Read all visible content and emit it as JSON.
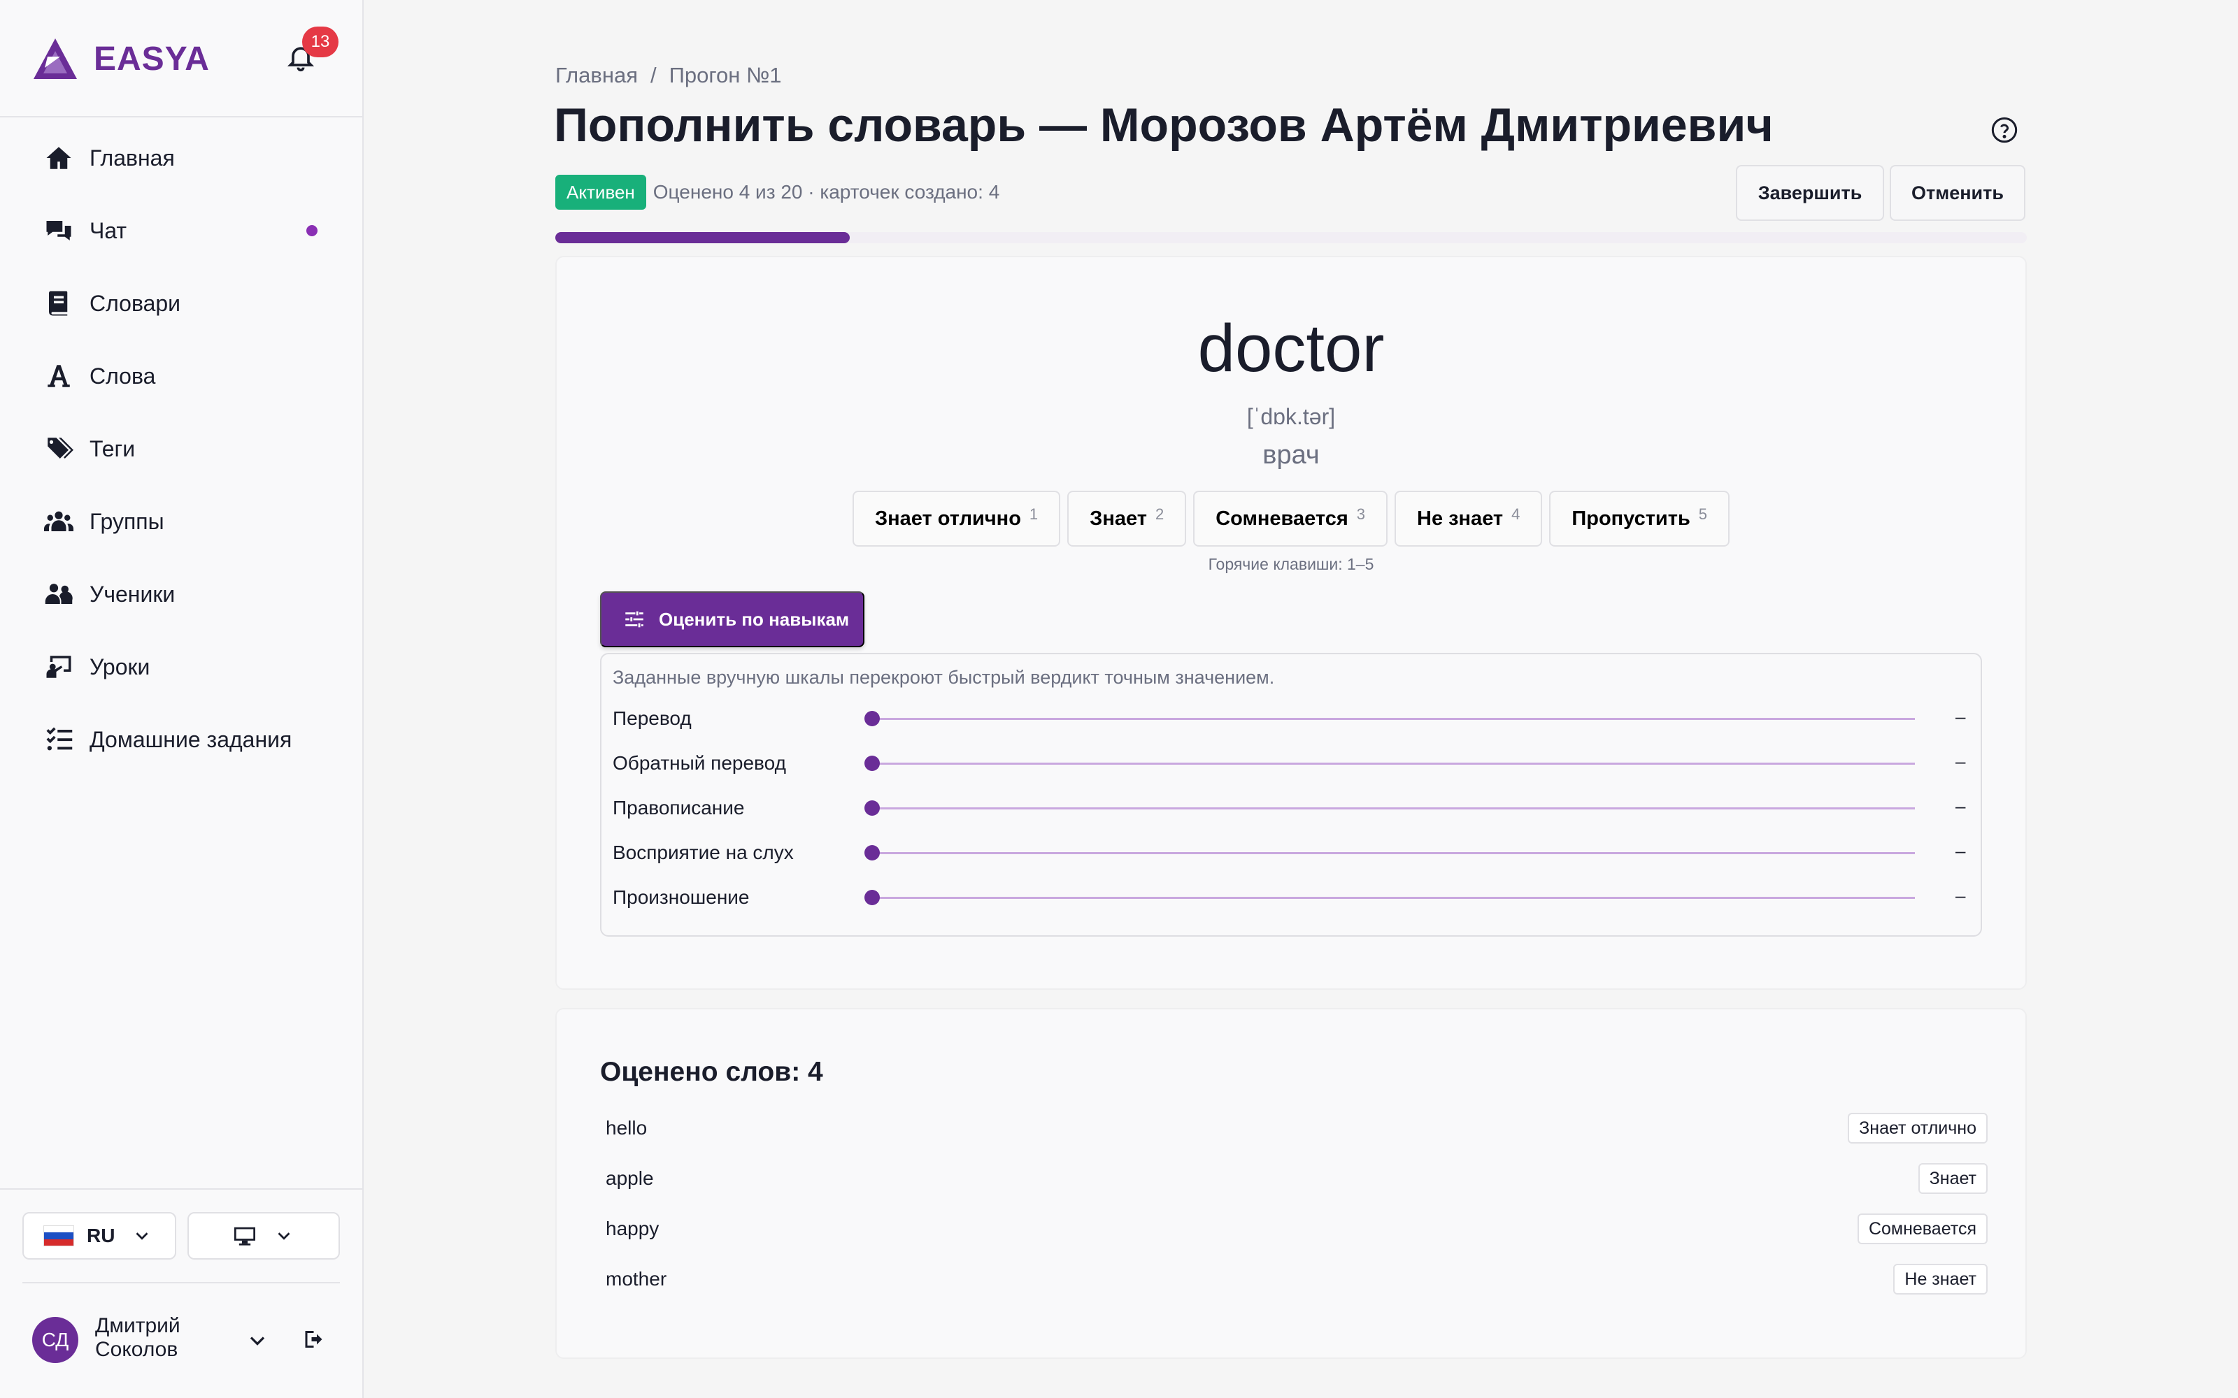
{
  "app": {
    "brand": "EASYA",
    "notifications_count": "13"
  },
  "sidebar": {
    "items": [
      {
        "label": "Главная",
        "icon": "home-icon"
      },
      {
        "label": "Чат",
        "icon": "chat-icon",
        "unread_dot": true
      },
      {
        "label": "Словари",
        "icon": "book-icon"
      },
      {
        "label": "Слова",
        "icon": "letter-a-icon"
      },
      {
        "label": "Теги",
        "icon": "tags-icon"
      },
      {
        "label": "Группы",
        "icon": "users-group-icon"
      },
      {
        "label": "Ученики",
        "icon": "students-icon"
      },
      {
        "label": "Уроки",
        "icon": "lesson-icon"
      },
      {
        "label": "Домашние задания",
        "icon": "homework-list-icon"
      }
    ],
    "language": "RU",
    "theme_icon": "monitor-icon",
    "user": {
      "initials": "СД",
      "name": "Дмитрий Соколов"
    }
  },
  "breadcrumb": {
    "home": "Главная",
    "separator": "/",
    "current": "Прогон №1"
  },
  "page": {
    "title": "Пополнить словарь — Морозов Артём Дмитриевич",
    "status": "Активен",
    "meta": "Оценено 4 из 20 · карточек создано: 4",
    "finish_label": "Завершить",
    "cancel_label": "Отменить",
    "progress": {
      "done": 4,
      "total": 20
    }
  },
  "card": {
    "word": "doctor",
    "ipa": "[ˈdɒk.tər]",
    "translation": "врач",
    "verdicts": [
      {
        "label": "Знает отлично",
        "key": "1"
      },
      {
        "label": "Знает",
        "key": "2"
      },
      {
        "label": "Сомневается",
        "key": "3"
      },
      {
        "label": "Не знает",
        "key": "4"
      },
      {
        "label": "Пропустить",
        "key": "5"
      }
    ],
    "hotkeys": "Горячие клавиши: 1–5",
    "skill_button": "Оценить по навыкам",
    "skills_note": "Заданные вручную шкалы перекроют быстрый вердикт точным значением.",
    "skills": [
      {
        "label": "Перевод",
        "value": "–"
      },
      {
        "label": "Обратный перевод",
        "value": "–"
      },
      {
        "label": "Правописание",
        "value": "–"
      },
      {
        "label": "Восприятие на слух",
        "value": "–"
      },
      {
        "label": "Произношение",
        "value": "–"
      }
    ]
  },
  "rated": {
    "title": "Оценено слов: 4",
    "items": [
      {
        "word": "hello",
        "verdict": "Знает отлично"
      },
      {
        "word": "apple",
        "verdict": "Знает"
      },
      {
        "word": "happy",
        "verdict": "Сомневается"
      },
      {
        "word": "mother",
        "verdict": "Не знает"
      }
    ]
  },
  "colors": {
    "accent": "#6a2d97",
    "status_active": "#18b07a",
    "badge": "#e53945",
    "dot": "#8a2fb4"
  }
}
